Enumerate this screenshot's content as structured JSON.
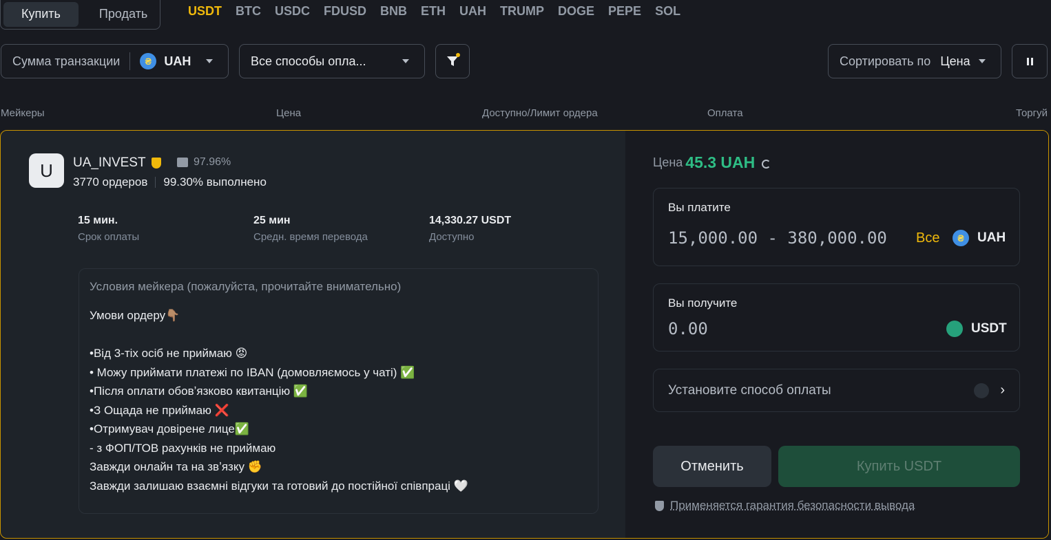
{
  "tabs": {
    "buy": "Купить",
    "sell": "Продать"
  },
  "coins": [
    "USDT",
    "BTC",
    "USDC",
    "FDUSD",
    "BNB",
    "ETH",
    "UAH",
    "TRUMP",
    "DOGE",
    "PEPE",
    "SOL"
  ],
  "filters": {
    "amount_label": "Сумма транзакции",
    "currency": "UAH",
    "payment_methods": "Все способы опла...",
    "sort_label": "Сортировать по",
    "sort_value": "Цена"
  },
  "table_header": {
    "makers": "Мейкеры",
    "price": "Цена",
    "available": "Доступно/Лимит ордера",
    "payment": "Оплата",
    "trade": "Торгуй"
  },
  "maker": {
    "avatar_letter": "U",
    "name": "UA_INVEST",
    "rating": "97.96%",
    "orders": "3770 ордеров",
    "completion": "99.30% выполнено",
    "payment_time_value": "15 мин.",
    "payment_time_label": "Срок оплаты",
    "avg_transfer_value": "25 мин",
    "avg_transfer_label": "Средн. время перевода",
    "available_value": "14,330.27 USDT",
    "available_label": "Доступно"
  },
  "terms": {
    "title": "Условия мейкера (пожалуйста, прочитайте внимательно)",
    "lines": [
      "Умови ордеру👇🏽",
      "",
      "•Від 3-тіх осіб не приймаю 😡",
      "• Можу приймати платежі по IBAN (домовляємось у чаті) ✅",
      "•Після оплати обовʼязково квитанцію ✅",
      "•З Ощада не приймаю ❌",
      "•Отримувач довірене лице✅",
      "- з ФОП/ТОВ рахунків не приймаю",
      "Завжди онлайн та на звʼязку ✊",
      "Завжди залишаю взаємні відгуки та готовий до постійної співпраці 🤍"
    ]
  },
  "order": {
    "price_label": "Цена",
    "price_value": "45.3 UAH",
    "pay_label": "Вы платите",
    "pay_range": "15,000.00 - 380,000.00",
    "pay_all": "Все",
    "pay_currency": "UAH",
    "receive_label": "Вы получите",
    "receive_value": "0.00",
    "receive_currency": "USDT",
    "set_payment": "Установите способ оплаты",
    "cancel": "Отменить",
    "buy": "Купить USDT",
    "guarantee": "Применяется гарантия безопасности вывода"
  },
  "colors": {
    "accent": "#f0b90b",
    "price_green": "#2ebd85",
    "buy_button": "#1e4e3a"
  },
  "icons": [
    "hryvnia-coin-icon",
    "caret-down-icon",
    "filter-icon",
    "pause-icon",
    "merchant-badge-icon",
    "thumbs-up-icon",
    "refresh-icon",
    "tether-icon",
    "chevron-right-icon",
    "shield-icon"
  ]
}
